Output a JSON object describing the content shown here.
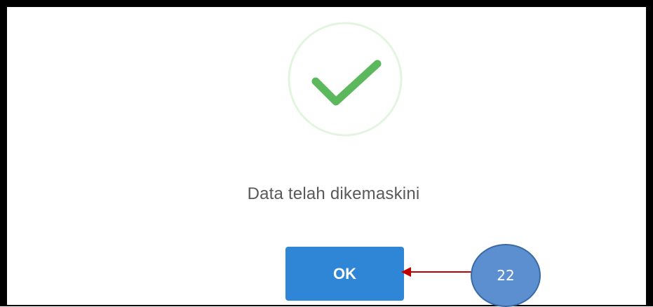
{
  "dialog": {
    "message": "Data telah dikemaskini",
    "ok_label": "OK",
    "icon": "checkmark-success-icon"
  },
  "annotation": {
    "badge_number": "22",
    "arrow_icon": "arrow-left-icon"
  },
  "colors": {
    "frame_border": "#000000",
    "check_green": "#5cb85c",
    "check_ring": "#e3f5e0",
    "button_blue": "#2f86d6",
    "message_text": "#595959",
    "badge_fill": "#5b8fcf",
    "arrow_red": "#c00000"
  }
}
